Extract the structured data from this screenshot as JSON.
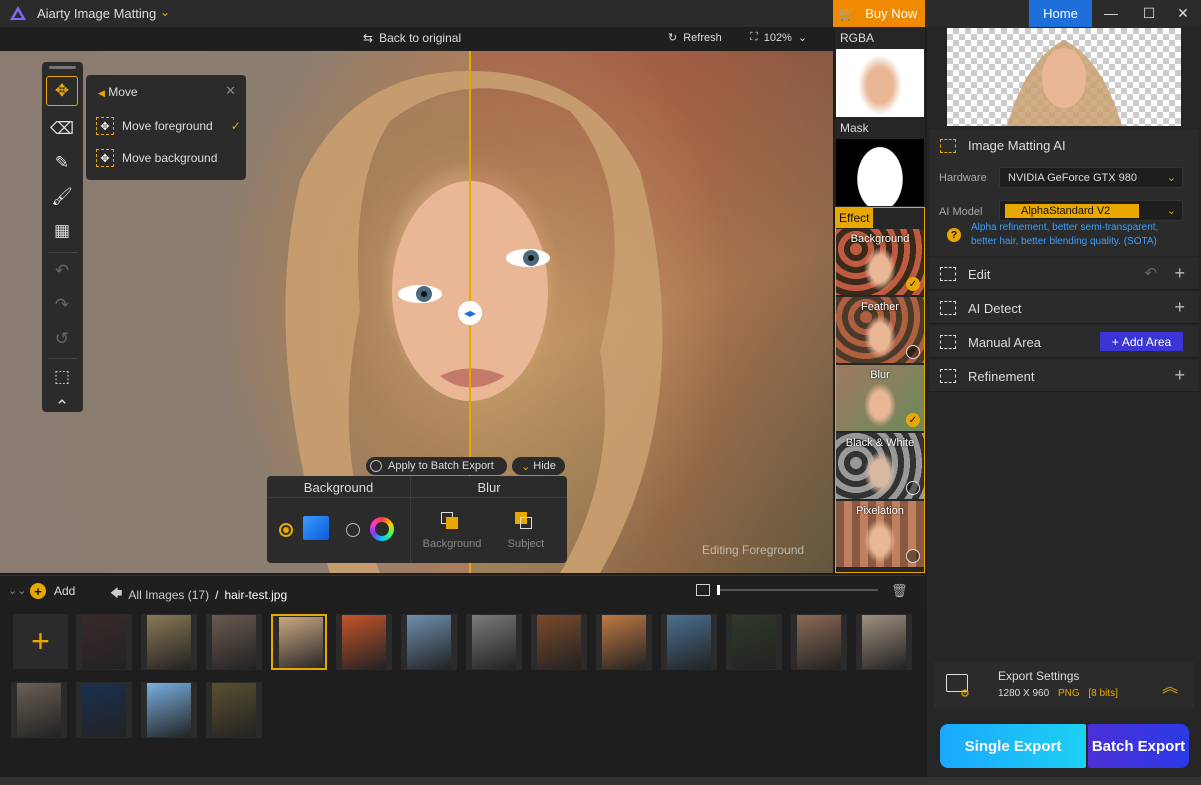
{
  "app": {
    "title": "Aiarty Image Matting",
    "buy_now": "Buy Now",
    "home": "Home"
  },
  "toolbar": {
    "back_to_original": "Back to original",
    "refresh": "Refresh",
    "zoom": "102%"
  },
  "canvas": {
    "status_text": "Editing Foreground"
  },
  "move_popup": {
    "title": "Move",
    "items": [
      {
        "label": "Move foreground",
        "checked": true
      },
      {
        "label": "Move background",
        "checked": false
      }
    ]
  },
  "batch": {
    "apply_label": "Apply to Batch Export",
    "hide_label": "Hide"
  },
  "effect_options": {
    "background_title": "Background",
    "blur_title": "Blur",
    "blur_options": [
      "Background",
      "Subject"
    ]
  },
  "effects": {
    "rgba_label": "RGBA",
    "mask_label": "Mask",
    "effect_label": "Effect",
    "items": [
      {
        "name": "Background",
        "selected": true
      },
      {
        "name": "Feather",
        "selected": false
      },
      {
        "name": "Blur",
        "selected": true
      },
      {
        "name": "Black & White",
        "selected": false
      },
      {
        "name": "Pixelation",
        "selected": false
      }
    ]
  },
  "right_panel": {
    "matting": {
      "title": "Image Matting AI",
      "hardware_label": "Hardware",
      "hardware_value": "NVIDIA GeForce GTX 980",
      "model_label": "AI Model",
      "model_value": "AlphaStandard  V2",
      "hint": "Alpha refinement, better semi-transparent, better hair, better blending quality. (SOTA)"
    },
    "sections": {
      "edit": "Edit",
      "ai_detect": "AI Detect",
      "manual_area": "Manual Area",
      "add_area": "Add Area",
      "refinement": "Refinement"
    },
    "export_settings": {
      "title": "Export Settings",
      "size": "1280 X 960",
      "format": "PNG",
      "bits": "[8 bits]"
    },
    "single_export": "Single Export",
    "batch_export": "Batch Export"
  },
  "bottom": {
    "add_label": "Add",
    "all_images": "All Images (17)",
    "separator": "/",
    "current_file": "hair-test.jpg"
  },
  "gallery_colors": [
    "#3a2a2a",
    "#8a7a55",
    "#6a5a50",
    "#caa885",
    "#c4542a",
    "#6f8fb0",
    "#7a7a7a",
    "#7a4a2a",
    "#c07a45",
    "#4a7090",
    "#2f3a2a",
    "#8a6a55",
    "#a09080",
    "#6a6055",
    "#1a3050",
    "#7ab0e0",
    "#5a5030"
  ],
  "colors": {
    "accent": "#e9a800",
    "orange": "#f08a00",
    "blue": "#1e6fd9",
    "link": "#3aa0ff"
  }
}
